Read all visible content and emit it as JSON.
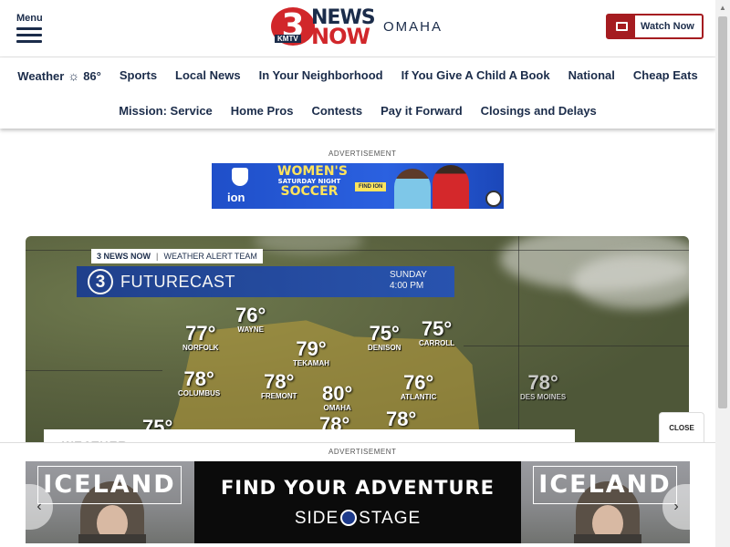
{
  "header": {
    "menu_label": "Menu",
    "logo": {
      "three": "3",
      "kmtv": "KMTV",
      "news": "NEWS",
      "now": "NOW",
      "city": "OMAHA"
    },
    "watch_now_label": "Watch Now"
  },
  "nav": {
    "row1": [
      {
        "label": "Weather",
        "temp": "86°"
      },
      {
        "label": "Sports"
      },
      {
        "label": "Local News"
      },
      {
        "label": "In Your Neighborhood"
      },
      {
        "label": "If You Give A Child A Book"
      },
      {
        "label": "National"
      },
      {
        "label": "Cheap Eats"
      }
    ],
    "row2": [
      {
        "label": "Mission: Service"
      },
      {
        "label": "Home Pros"
      },
      {
        "label": "Contests"
      },
      {
        "label": "Pay it Forward"
      },
      {
        "label": "Closings and Delays"
      }
    ]
  },
  "ad_top": {
    "label": "ADVERTISEMENT",
    "brand": "ion",
    "headline_1": "WOMEN'S",
    "headline_mid": "SATURDAY NIGHT",
    "headline_2": "SOCCER",
    "cta": "FIND ION"
  },
  "weather_map": {
    "tag_brand": "3 NEWS NOW",
    "tag_team": "WEATHER ALERT TEAM",
    "logo_three": "3",
    "title": "FUTURECAST",
    "day": "SUNDAY",
    "time": "4:00 PM",
    "temps": [
      {
        "value": "77°",
        "city": "NORFOLK"
      },
      {
        "value": "76°",
        "city": "WAYNE"
      },
      {
        "value": "79°",
        "city": "TEKAMAH"
      },
      {
        "value": "75°",
        "city": "DENISON"
      },
      {
        "value": "75°",
        "city": "CARROLL"
      },
      {
        "value": "78°",
        "city": "COLUMBUS"
      },
      {
        "value": "78°",
        "city": "FREMONT"
      },
      {
        "value": "80°",
        "city": "OMAHA"
      },
      {
        "value": "76°",
        "city": "ATLANTIC"
      },
      {
        "value": "78°",
        "city": "DES MOINES"
      },
      {
        "value": "75°",
        "city": ""
      },
      {
        "value": "78°",
        "city": ""
      },
      {
        "value": "78°",
        "city": ""
      }
    ],
    "lower_card_text": "WEATHER"
  },
  "close_label": "CLOSE",
  "ad_bottom": {
    "label": "ADVERTISEMENT",
    "left_title": "ICELAND",
    "right_title": "ICELAND",
    "headline": "FIND YOUR ADVENTURE",
    "brand_left": "SIDE",
    "brand_right": "STAGE",
    "prev_arrow": "‹",
    "next_arrow": "›"
  }
}
